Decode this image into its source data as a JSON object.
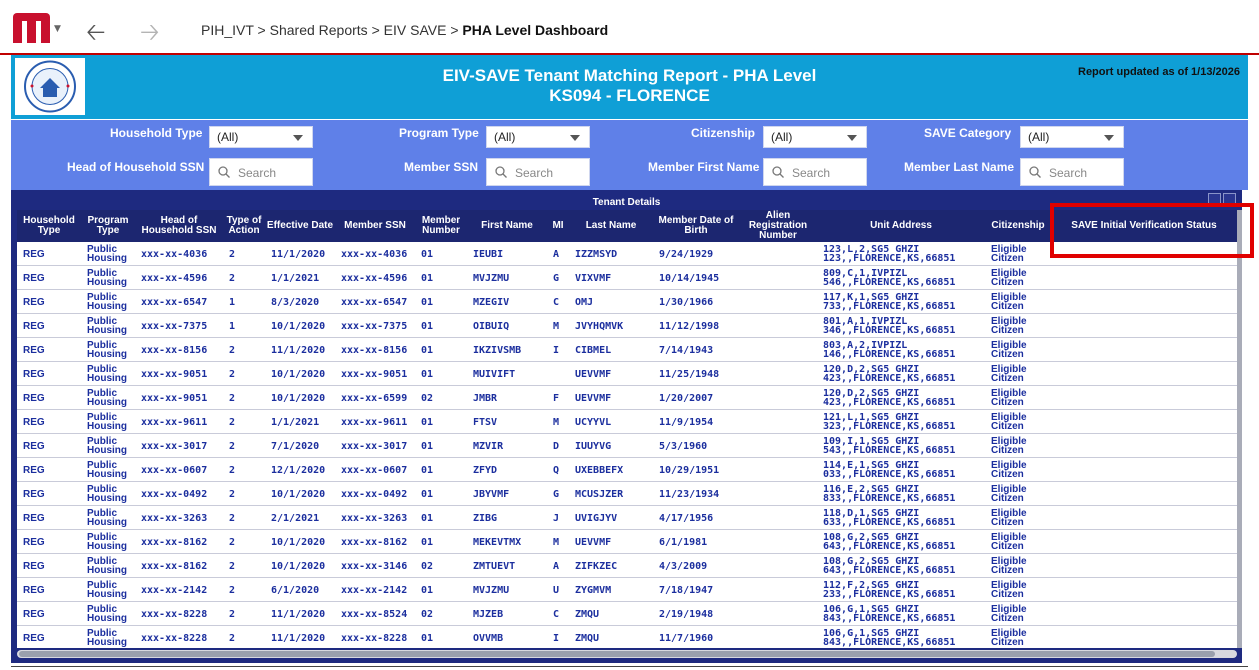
{
  "nav": {
    "breadcrumb": [
      "PIH_IVT",
      "Shared Reports",
      "EIV SAVE"
    ],
    "breadcrumb_sep": " > ",
    "current": "PHA Level Dashboard",
    "back_icon": "arrow-left-icon",
    "forward_icon": "arrow-right-icon"
  },
  "report": {
    "title": "EIV-SAVE Tenant Matching Report - PHA Level",
    "subtitle": "KS094 - FLORENCE",
    "updated": "Report updated as of 1/13/2026"
  },
  "filters": {
    "household_type": {
      "label": "Household Type",
      "value": "(All)"
    },
    "program_type": {
      "label": "Program Type",
      "value": "(All)"
    },
    "citizenship": {
      "label": "Citizenship",
      "value": "(All)"
    },
    "save_category": {
      "label": "SAVE Category",
      "value": "(All)"
    },
    "hoh_ssn": {
      "label": "Head of Household SSN",
      "placeholder": "Search"
    },
    "member_ssn": {
      "label": "Member SSN",
      "placeholder": "Search"
    },
    "member_first": {
      "label": "Member First Name",
      "placeholder": "Search"
    },
    "member_last": {
      "label": "Member Last Name",
      "placeholder": "Search"
    }
  },
  "table": {
    "title": "Tenant Details",
    "columns": [
      "Household Type",
      "Program Type",
      "Head of Household SSN",
      "Type of Action",
      "Effective Date",
      "Member SSN",
      "Member Number",
      "First Name",
      "MI",
      "Last Name",
      "Member Date of Birth",
      "Alien Registration Number",
      "Unit Address",
      "Citizenship",
      "SAVE Initial Verification Status"
    ],
    "rows": [
      {
        "hh": "REG",
        "prog": "Public Housing",
        "hoh": "xxx-xx-4036",
        "act": "2",
        "eff": "11/1/2020",
        "mssn": "xxx-xx-4036",
        "num": "01",
        "first": "IEUBI",
        "mi": "A",
        "last": "IZZMSYD",
        "dob": "9/24/1929",
        "alien": "",
        "addr1": "123,L,2,SG5 GHZI",
        "addr2": "123,,FLORENCE,KS,66851",
        "cit": "Eligible Citizen",
        "save": ""
      },
      {
        "hh": "REG",
        "prog": "Public Housing",
        "hoh": "xxx-xx-4596",
        "act": "2",
        "eff": "1/1/2021",
        "mssn": "xxx-xx-4596",
        "num": "01",
        "first": "MVJZMU",
        "mi": "G",
        "last": "VIXVMF",
        "dob": "10/14/1945",
        "alien": "",
        "addr1": "809,C,1,IVPIZL",
        "addr2": "546,,FLORENCE,KS,66851",
        "cit": "Eligible Citizen",
        "save": ""
      },
      {
        "hh": "REG",
        "prog": "Public Housing",
        "hoh": "xxx-xx-6547",
        "act": "1",
        "eff": "8/3/2020",
        "mssn": "xxx-xx-6547",
        "num": "01",
        "first": "MZEGIV",
        "mi": "C",
        "last": "OMJ",
        "dob": "1/30/1966",
        "alien": "",
        "addr1": "117,K,1,SG5 GHZI",
        "addr2": "733,,FLORENCE,KS,66851",
        "cit": "Eligible Citizen",
        "save": ""
      },
      {
        "hh": "REG",
        "prog": "Public Housing",
        "hoh": "xxx-xx-7375",
        "act": "1",
        "eff": "10/1/2020",
        "mssn": "xxx-xx-7375",
        "num": "01",
        "first": "OIBUIQ",
        "mi": "M",
        "last": "JVYHQMVK",
        "dob": "11/12/1998",
        "alien": "",
        "addr1": "801,A,1,IVPIZL",
        "addr2": "346,,FLORENCE,KS,66851",
        "cit": "Eligible Citizen",
        "save": ""
      },
      {
        "hh": "REG",
        "prog": "Public Housing",
        "hoh": "xxx-xx-8156",
        "act": "2",
        "eff": "11/1/2020",
        "mssn": "xxx-xx-8156",
        "num": "01",
        "first": "IKZIVSMB",
        "mi": "I",
        "last": "CIBMEL",
        "dob": "7/14/1943",
        "alien": "",
        "addr1": "803,A,2,IVPIZL",
        "addr2": "146,,FLORENCE,KS,66851",
        "cit": "Eligible Citizen",
        "save": ""
      },
      {
        "hh": "REG",
        "prog": "Public Housing",
        "hoh": "xxx-xx-9051",
        "act": "2",
        "eff": "10/1/2020",
        "mssn": "xxx-xx-9051",
        "num": "01",
        "first": "MUIVIFT",
        "mi": "",
        "last": "UEVVMF",
        "dob": "11/25/1948",
        "alien": "",
        "addr1": "120,D,2,SG5 GHZI",
        "addr2": "423,,FLORENCE,KS,66851",
        "cit": "Eligible Citizen",
        "save": ""
      },
      {
        "hh": "REG",
        "prog": "Public Housing",
        "hoh": "xxx-xx-9051",
        "act": "2",
        "eff": "10/1/2020",
        "mssn": "xxx-xx-6599",
        "num": "02",
        "first": "JMBR",
        "mi": "F",
        "last": "UEVVMF",
        "dob": "1/20/2007",
        "alien": "",
        "addr1": "120,D,2,SG5 GHZI",
        "addr2": "423,,FLORENCE,KS,66851",
        "cit": "Eligible Citizen",
        "save": ""
      },
      {
        "hh": "REG",
        "prog": "Public Housing",
        "hoh": "xxx-xx-9611",
        "act": "2",
        "eff": "1/1/2021",
        "mssn": "xxx-xx-9611",
        "num": "01",
        "first": "FTSV",
        "mi": "M",
        "last": "UCYYVL",
        "dob": "11/9/1954",
        "alien": "",
        "addr1": "121,L,1,SG5 GHZI",
        "addr2": "323,,FLORENCE,KS,66851",
        "cit": "Eligible Citizen",
        "save": ""
      },
      {
        "hh": "REG",
        "prog": "Public Housing",
        "hoh": "xxx-xx-3017",
        "act": "2",
        "eff": "7/1/2020",
        "mssn": "xxx-xx-3017",
        "num": "01",
        "first": "MZVIR",
        "mi": "D",
        "last": "IUUYVG",
        "dob": "5/3/1960",
        "alien": "",
        "addr1": "109,I,1,SG5 GHZI",
        "addr2": "543,,FLORENCE,KS,66851",
        "cit": "Eligible Citizen",
        "save": ""
      },
      {
        "hh": "REG",
        "prog": "Public Housing",
        "hoh": "xxx-xx-0607",
        "act": "2",
        "eff": "12/1/2020",
        "mssn": "xxx-xx-0607",
        "num": "01",
        "first": "ZFYD",
        "mi": "Q",
        "last": "UXEBBEFX",
        "dob": "10/29/1951",
        "alien": "",
        "addr1": "114,E,1,SG5 GHZI",
        "addr2": "033,,FLORENCE,KS,66851",
        "cit": "Eligible Citizen",
        "save": ""
      },
      {
        "hh": "REG",
        "prog": "Public Housing",
        "hoh": "xxx-xx-0492",
        "act": "2",
        "eff": "10/1/2020",
        "mssn": "xxx-xx-0492",
        "num": "01",
        "first": "JBYVMF",
        "mi": "G",
        "last": "MCUSJZER",
        "dob": "11/23/1934",
        "alien": "",
        "addr1": "116,E,2,SG5 GHZI",
        "addr2": "833,,FLORENCE,KS,66851",
        "cit": "Eligible Citizen",
        "save": ""
      },
      {
        "hh": "REG",
        "prog": "Public Housing",
        "hoh": "xxx-xx-3263",
        "act": "2",
        "eff": "2/1/2021",
        "mssn": "xxx-xx-3263",
        "num": "01",
        "first": "ZIBG",
        "mi": "J",
        "last": "UVIGJYV",
        "dob": "4/17/1956",
        "alien": "",
        "addr1": "118,D,1,SG5 GHZI",
        "addr2": "633,,FLORENCE,KS,66851",
        "cit": "Eligible Citizen",
        "save": ""
      },
      {
        "hh": "REG",
        "prog": "Public Housing",
        "hoh": "xxx-xx-8162",
        "act": "2",
        "eff": "10/1/2020",
        "mssn": "xxx-xx-8162",
        "num": "01",
        "first": "MEKEVTMX",
        "mi": "M",
        "last": "UEVVMF",
        "dob": "6/1/1981",
        "alien": "",
        "addr1": "108,G,2,SG5 GHZI",
        "addr2": "643,,FLORENCE,KS,66851",
        "cit": "Eligible Citizen",
        "save": ""
      },
      {
        "hh": "REG",
        "prog": "Public Housing",
        "hoh": "xxx-xx-8162",
        "act": "2",
        "eff": "10/1/2020",
        "mssn": "xxx-xx-3146",
        "num": "02",
        "first": "ZMTUEVT",
        "mi": "A",
        "last": "ZIFKZEC",
        "dob": "4/3/2009",
        "alien": "",
        "addr1": "108,G,2,SG5 GHZI",
        "addr2": "643,,FLORENCE,KS,66851",
        "cit": "Eligible Citizen",
        "save": ""
      },
      {
        "hh": "REG",
        "prog": "Public Housing",
        "hoh": "xxx-xx-2142",
        "act": "2",
        "eff": "6/1/2020",
        "mssn": "xxx-xx-2142",
        "num": "01",
        "first": "MVJZMU",
        "mi": "U",
        "last": "ZYGMVM",
        "dob": "7/18/1947",
        "alien": "",
        "addr1": "112,F,2,SG5 GHZI",
        "addr2": "233,,FLORENCE,KS,66851",
        "cit": "Eligible Citizen",
        "save": ""
      },
      {
        "hh": "REG",
        "prog": "Public Housing",
        "hoh": "xxx-xx-8228",
        "act": "2",
        "eff": "11/1/2020",
        "mssn": "xxx-xx-8524",
        "num": "02",
        "first": "MJZEB",
        "mi": "C",
        "last": "ZMQU",
        "dob": "2/19/1948",
        "alien": "",
        "addr1": "106,G,1,SG5 GHZI",
        "addr2": "843,,FLORENCE,KS,66851",
        "cit": "Eligible Citizen",
        "save": ""
      },
      {
        "hh": "REG",
        "prog": "Public Housing",
        "hoh": "xxx-xx-8228",
        "act": "2",
        "eff": "11/1/2020",
        "mssn": "xxx-xx-8228",
        "num": "01",
        "first": "OVVMB",
        "mi": "I",
        "last": "ZMQU",
        "dob": "11/7/1960",
        "alien": "",
        "addr1": "106,G,1,SG5 GHZI",
        "addr2": "843,,FLORENCE,KS,66851",
        "cit": "Eligible Citizen",
        "save": ""
      }
    ]
  },
  "colors": {
    "header_bg": "#0f9fd6",
    "filter_bg": "#5f80e8",
    "table_header_bg": "#1c2670",
    "cell_text": "#1b2e9e",
    "highlight": "#e00000",
    "logo_red": "#c8102e"
  }
}
